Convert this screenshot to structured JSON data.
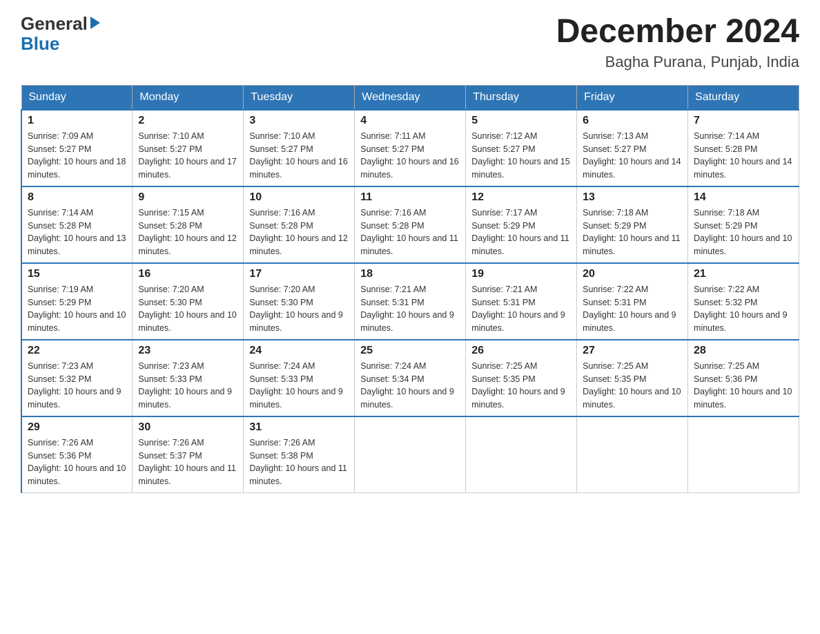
{
  "logo": {
    "line1": "General",
    "line2": "Blue"
  },
  "title": "December 2024",
  "subtitle": "Bagha Purana, Punjab, India",
  "headers": [
    "Sunday",
    "Monday",
    "Tuesday",
    "Wednesday",
    "Thursday",
    "Friday",
    "Saturday"
  ],
  "weeks": [
    [
      {
        "day": "1",
        "sunrise": "7:09 AM",
        "sunset": "5:27 PM",
        "daylight": "10 hours and 18 minutes."
      },
      {
        "day": "2",
        "sunrise": "7:10 AM",
        "sunset": "5:27 PM",
        "daylight": "10 hours and 17 minutes."
      },
      {
        "day": "3",
        "sunrise": "7:10 AM",
        "sunset": "5:27 PM",
        "daylight": "10 hours and 16 minutes."
      },
      {
        "day": "4",
        "sunrise": "7:11 AM",
        "sunset": "5:27 PM",
        "daylight": "10 hours and 16 minutes."
      },
      {
        "day": "5",
        "sunrise": "7:12 AM",
        "sunset": "5:27 PM",
        "daylight": "10 hours and 15 minutes."
      },
      {
        "day": "6",
        "sunrise": "7:13 AM",
        "sunset": "5:27 PM",
        "daylight": "10 hours and 14 minutes."
      },
      {
        "day": "7",
        "sunrise": "7:14 AM",
        "sunset": "5:28 PM",
        "daylight": "10 hours and 14 minutes."
      }
    ],
    [
      {
        "day": "8",
        "sunrise": "7:14 AM",
        "sunset": "5:28 PM",
        "daylight": "10 hours and 13 minutes."
      },
      {
        "day": "9",
        "sunrise": "7:15 AM",
        "sunset": "5:28 PM",
        "daylight": "10 hours and 12 minutes."
      },
      {
        "day": "10",
        "sunrise": "7:16 AM",
        "sunset": "5:28 PM",
        "daylight": "10 hours and 12 minutes."
      },
      {
        "day": "11",
        "sunrise": "7:16 AM",
        "sunset": "5:28 PM",
        "daylight": "10 hours and 11 minutes."
      },
      {
        "day": "12",
        "sunrise": "7:17 AM",
        "sunset": "5:29 PM",
        "daylight": "10 hours and 11 minutes."
      },
      {
        "day": "13",
        "sunrise": "7:18 AM",
        "sunset": "5:29 PM",
        "daylight": "10 hours and 11 minutes."
      },
      {
        "day": "14",
        "sunrise": "7:18 AM",
        "sunset": "5:29 PM",
        "daylight": "10 hours and 10 minutes."
      }
    ],
    [
      {
        "day": "15",
        "sunrise": "7:19 AM",
        "sunset": "5:29 PM",
        "daylight": "10 hours and 10 minutes."
      },
      {
        "day": "16",
        "sunrise": "7:20 AM",
        "sunset": "5:30 PM",
        "daylight": "10 hours and 10 minutes."
      },
      {
        "day": "17",
        "sunrise": "7:20 AM",
        "sunset": "5:30 PM",
        "daylight": "10 hours and 9 minutes."
      },
      {
        "day": "18",
        "sunrise": "7:21 AM",
        "sunset": "5:31 PM",
        "daylight": "10 hours and 9 minutes."
      },
      {
        "day": "19",
        "sunrise": "7:21 AM",
        "sunset": "5:31 PM",
        "daylight": "10 hours and 9 minutes."
      },
      {
        "day": "20",
        "sunrise": "7:22 AM",
        "sunset": "5:31 PM",
        "daylight": "10 hours and 9 minutes."
      },
      {
        "day": "21",
        "sunrise": "7:22 AM",
        "sunset": "5:32 PM",
        "daylight": "10 hours and 9 minutes."
      }
    ],
    [
      {
        "day": "22",
        "sunrise": "7:23 AM",
        "sunset": "5:32 PM",
        "daylight": "10 hours and 9 minutes."
      },
      {
        "day": "23",
        "sunrise": "7:23 AM",
        "sunset": "5:33 PM",
        "daylight": "10 hours and 9 minutes."
      },
      {
        "day": "24",
        "sunrise": "7:24 AM",
        "sunset": "5:33 PM",
        "daylight": "10 hours and 9 minutes."
      },
      {
        "day": "25",
        "sunrise": "7:24 AM",
        "sunset": "5:34 PM",
        "daylight": "10 hours and 9 minutes."
      },
      {
        "day": "26",
        "sunrise": "7:25 AM",
        "sunset": "5:35 PM",
        "daylight": "10 hours and 9 minutes."
      },
      {
        "day": "27",
        "sunrise": "7:25 AM",
        "sunset": "5:35 PM",
        "daylight": "10 hours and 10 minutes."
      },
      {
        "day": "28",
        "sunrise": "7:25 AM",
        "sunset": "5:36 PM",
        "daylight": "10 hours and 10 minutes."
      }
    ],
    [
      {
        "day": "29",
        "sunrise": "7:26 AM",
        "sunset": "5:36 PM",
        "daylight": "10 hours and 10 minutes."
      },
      {
        "day": "30",
        "sunrise": "7:26 AM",
        "sunset": "5:37 PM",
        "daylight": "10 hours and 11 minutes."
      },
      {
        "day": "31",
        "sunrise": "7:26 AM",
        "sunset": "5:38 PM",
        "daylight": "10 hours and 11 minutes."
      },
      null,
      null,
      null,
      null
    ]
  ]
}
